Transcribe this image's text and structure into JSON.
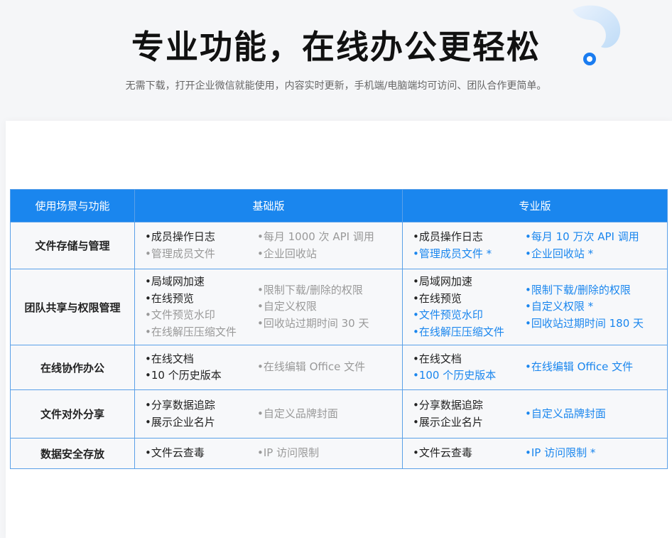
{
  "hero": {
    "title": "专业功能，在线办公更轻松",
    "subtitle": "无需下载，打开企业微信就能使用，内容实时更新，手机端/电脑端均可访问、团队合作更简单。"
  },
  "colors": {
    "accent": "#1a86ee",
    "enabled": "#222222",
    "disabled": "#999999"
  },
  "table": {
    "headers": [
      "使用场景与功能",
      "基础版",
      "专业版"
    ],
    "rows": [
      {
        "label": "文件存储与管理",
        "basic": {
          "left": [
            {
              "text": "•成员操作日志",
              "state": "on"
            },
            {
              "text": "•管理成员文件",
              "state": "off"
            }
          ],
          "right": [
            {
              "text": "•每月 1000 次 API 调用",
              "state": "off"
            },
            {
              "text": "•企业回收站",
              "state": "off"
            }
          ]
        },
        "pro": {
          "left": [
            {
              "text": "•成员操作日志",
              "state": "on"
            },
            {
              "text": "•管理成员文件 *",
              "state": "pro"
            }
          ],
          "right": [
            {
              "text": "•每月 10 万次 API 调用",
              "state": "pro"
            },
            {
              "text": "•企业回收站 *",
              "state": "pro"
            }
          ]
        }
      },
      {
        "label": "团队共享与权限管理",
        "basic": {
          "left": [
            {
              "text": "•局域网加速",
              "state": "on"
            },
            {
              "text": "•在线预览",
              "state": "on"
            },
            {
              "text": "•文件预览水印",
              "state": "off"
            },
            {
              "text": "•在线解压压缩文件",
              "state": "off"
            }
          ],
          "right": [
            {
              "text": "•限制下载/删除的权限",
              "state": "off"
            },
            {
              "text": "•自定义权限",
              "state": "off"
            },
            {
              "text": "•回收站过期时间 30 天",
              "state": "off"
            }
          ]
        },
        "pro": {
          "left": [
            {
              "text": "•局域网加速",
              "state": "on"
            },
            {
              "text": "•在线预览",
              "state": "on"
            },
            {
              "text": "•文件预览水印",
              "state": "pro"
            },
            {
              "text": "•在线解压压缩文件",
              "state": "pro"
            }
          ],
          "right": [
            {
              "text": "•限制下载/删除的权限",
              "state": "pro"
            },
            {
              "text": "•自定义权限 *",
              "state": "pro"
            },
            {
              "text": "•回收站过期时间 180 天",
              "state": "pro"
            }
          ]
        }
      },
      {
        "label": "在线协作办公",
        "basic": {
          "left": [
            {
              "text": "•在线文档",
              "state": "on"
            },
            {
              "text": "•10 个历史版本",
              "state": "on"
            }
          ],
          "right": [
            {
              "text": "•在线编辑 Office 文件",
              "state": "off"
            }
          ]
        },
        "pro": {
          "left": [
            {
              "text": "•在线文档",
              "state": "on"
            },
            {
              "text": "•100 个历史版本",
              "state": "pro"
            }
          ],
          "right": [
            {
              "text": "•在线编辑 Office 文件",
              "state": "pro"
            }
          ]
        }
      },
      {
        "label": "文件对外分享",
        "basic": {
          "left": [
            {
              "text": "•分享数据追踪",
              "state": "on"
            },
            {
              "text": "•展示企业名片",
              "state": "on"
            }
          ],
          "right": [
            {
              "text": "•自定义品牌封面",
              "state": "off"
            }
          ]
        },
        "pro": {
          "left": [
            {
              "text": "•分享数据追踪",
              "state": "on"
            },
            {
              "text": "•展示企业名片",
              "state": "on"
            }
          ],
          "right": [
            {
              "text": "•自定义品牌封面",
              "state": "pro"
            }
          ]
        }
      },
      {
        "label": "数据安全存放",
        "basic": {
          "left": [
            {
              "text": "•文件云查毒",
              "state": "on"
            }
          ],
          "right": [
            {
              "text": "•IP 访问限制",
              "state": "off"
            }
          ]
        },
        "pro": {
          "left": [
            {
              "text": "•文件云查毒",
              "state": "on"
            }
          ],
          "right": [
            {
              "text": "•IP 访问限制 *",
              "state": "pro"
            }
          ]
        }
      }
    ]
  }
}
